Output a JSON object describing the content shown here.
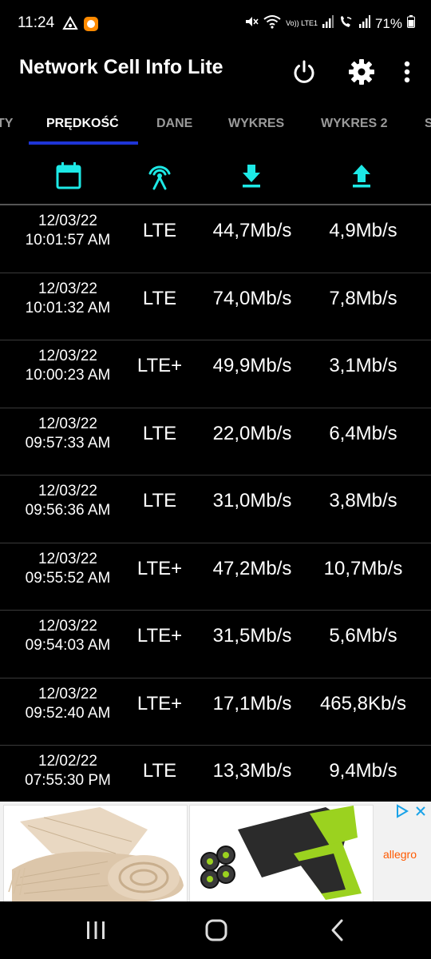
{
  "status_bar": {
    "time": "11:24",
    "volte_label": "Vo)) LTE1",
    "battery": "71%"
  },
  "app_bar": {
    "title": "Network Cell Info Lite",
    "actions": [
      "power-icon",
      "gear-icon",
      "more-vert-icon"
    ]
  },
  "tabs": [
    {
      "label": "TY"
    },
    {
      "label": "PRĘDKOŚĆ",
      "active": true
    },
    {
      "label": "DANE"
    },
    {
      "label": "WYKRES"
    },
    {
      "label": "WYKRES 2"
    },
    {
      "label": "S"
    }
  ],
  "column_icons": [
    "calendar-icon",
    "antenna-icon",
    "download-icon",
    "upload-icon"
  ],
  "accent_color": "#1de9e6",
  "tab_indicator_color": "#1e35d6",
  "rows": [
    {
      "date": "12/03/22",
      "time": "10:01:57 AM",
      "tech": "LTE",
      "down": "44,7Mb/s",
      "up": "4,9Mb/s"
    },
    {
      "date": "12/03/22",
      "time": "10:01:32 AM",
      "tech": "LTE",
      "down": "74,0Mb/s",
      "up": "7,8Mb/s"
    },
    {
      "date": "12/03/22",
      "time": "10:00:23 AM",
      "tech": "LTE+",
      "down": "49,9Mb/s",
      "up": "3,1Mb/s"
    },
    {
      "date": "12/03/22",
      "time": "09:57:33 AM",
      "tech": "LTE",
      "down": "22,0Mb/s",
      "up": "6,4Mb/s"
    },
    {
      "date": "12/03/22",
      "time": "09:56:36 AM",
      "tech": "LTE",
      "down": "31,0Mb/s",
      "up": "3,8Mb/s"
    },
    {
      "date": "12/03/22",
      "time": "09:55:52 AM",
      "tech": "LTE+",
      "down": "47,2Mb/s",
      "up": "10,7Mb/s"
    },
    {
      "date": "12/03/22",
      "time": "09:54:03 AM",
      "tech": "LTE+",
      "down": "31,5Mb/s",
      "up": "5,6Mb/s"
    },
    {
      "date": "12/03/22",
      "time": "09:52:40 AM",
      "tech": "LTE+",
      "down": "17,1Mb/s",
      "up": "465,8Kb/s"
    },
    {
      "date": "12/02/22",
      "time": "07:55:30 PM",
      "tech": "LTE",
      "down": "13,3Mb/s",
      "up": "9,4Mb/s"
    }
  ],
  "ad": {
    "brand": "allegro"
  }
}
